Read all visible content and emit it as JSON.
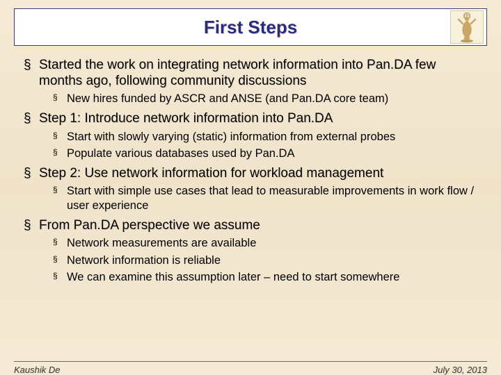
{
  "title": "First Steps",
  "bullets": [
    {
      "text": "Started the work on integrating network information into Pan.DA few months ago, following community discussions",
      "sub": [
        "New hires funded by ASCR and ANSE (and Pan.DA core team)"
      ]
    },
    {
      "text": "Step 1: Introduce network information into Pan.DA",
      "sub": [
        "Start with slowly varying (static) information from external probes",
        "Populate various databases used by Pan.DA"
      ]
    },
    {
      "text": "Step 2: Use network information for workload management",
      "sub": [
        "Start with simple use cases that lead to measurable improvements in work flow / user experience"
      ]
    },
    {
      "text": "From Pan.DA perspective we assume",
      "sub": [
        "Network measurements are available",
        "Network information is reliable",
        "We can examine this assumption later – need to start somewhere"
      ]
    }
  ],
  "footer": {
    "left": "Kaushik De",
    "right": "July 30, 2013"
  }
}
